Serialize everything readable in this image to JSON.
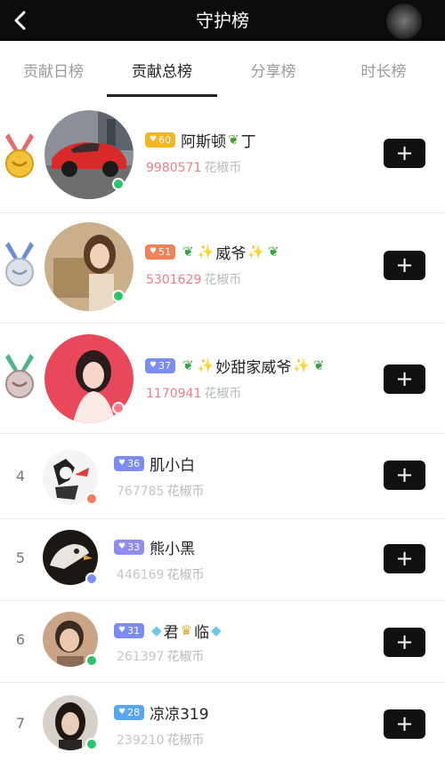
{
  "header": {
    "title": "守护榜"
  },
  "tabs": [
    {
      "label": "贡献日榜",
      "active": false
    },
    {
      "label": "贡献总榜",
      "active": true
    },
    {
      "label": "分享榜",
      "active": false
    },
    {
      "label": "时长榜",
      "active": false
    }
  ],
  "rows": [
    {
      "rank": "1",
      "level": "60",
      "name": "阿斯顿",
      "name_suffix": "丁",
      "score": "9980571",
      "unit": "花椒币",
      "badge_color": "#f5b523",
      "score_color": "pink",
      "follow_label": "+"
    },
    {
      "rank": "2",
      "level": "51",
      "name": "威爷",
      "score": "5301629",
      "unit": "花椒币",
      "badge_color": "#f0825a",
      "score_color": "pink",
      "follow_label": "+"
    },
    {
      "rank": "3",
      "level": "37",
      "name": "妙甜家威爷",
      "score": "1170941",
      "unit": "花椒币",
      "badge_color": "#7b8cf2",
      "score_color": "pink",
      "follow_label": "+"
    },
    {
      "rank": "4",
      "level": "36",
      "name": "肌小白",
      "score": "767785",
      "unit": "花椒币",
      "badge_color": "#7b8cf2",
      "score_color": "grey",
      "follow_label": "+"
    },
    {
      "rank": "5",
      "level": "33",
      "name": "熊小黑",
      "score": "446169",
      "unit": "花椒币",
      "badge_color": "#8f8cf2",
      "score_color": "grey",
      "follow_label": "+"
    },
    {
      "rank": "6",
      "level": "31",
      "name": "君",
      "name_suffix": "临",
      "score": "261397",
      "unit": "花椒币",
      "badge_color": "#7b8cf2",
      "score_color": "grey",
      "follow_label": "+"
    },
    {
      "rank": "7",
      "level": "28",
      "name": "凉凉319",
      "score": "239210",
      "unit": "花椒币",
      "badge_color": "#57a6f0",
      "score_color": "grey",
      "follow_label": "+"
    }
  ]
}
